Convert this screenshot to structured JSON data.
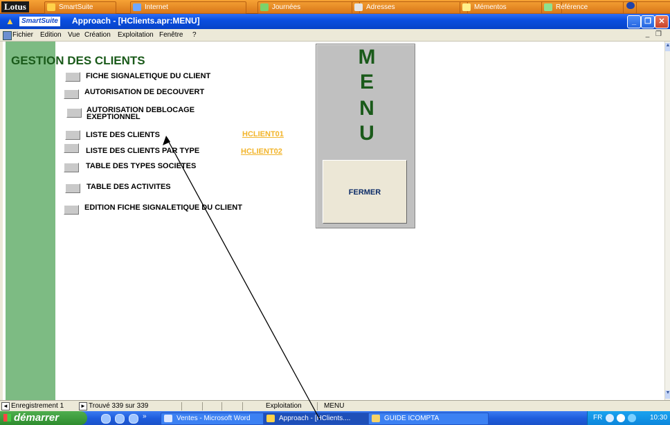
{
  "suitebar": {
    "logo": "Lotus",
    "items": [
      {
        "label": "SmartSuite"
      },
      {
        "label": "Internet"
      },
      {
        "label": "Journées"
      },
      {
        "label": "Adresses"
      },
      {
        "label": "Mémentos"
      },
      {
        "label": "Référence"
      }
    ]
  },
  "titlebar": {
    "brand": "SmartSuite",
    "title": "Approach - [HClients.apr:MENU]",
    "minimize": "_",
    "restore": "❐",
    "close": "✕"
  },
  "menubar": {
    "items": [
      "Fichier",
      "Edition",
      "Vue",
      "Création",
      "Exploitation",
      "Fenêtre",
      "?"
    ]
  },
  "form": {
    "heading": "GESTION DES CLIENTS",
    "buttons": [
      {
        "label": "FICHE SIGNALETIQUE DU CLIENT"
      },
      {
        "label": "AUTORISATION DE DECOUVERT"
      },
      {
        "label": "AUTORISATION DEBLOCAGE\nEXEPTIONNEL"
      },
      {
        "label": "LISTE DES CLIENTS",
        "code": "HCLIENT01"
      },
      {
        "label": "LISTE DES CLIENTS PAR TYPE",
        "code": "HCLIENT02"
      },
      {
        "label": "TABLE DES TYPES SOCIETES"
      },
      {
        "label": "TABLE DES ACTIVITES"
      },
      {
        "label": "EDITION FICHE SIGNALETIQUE DU CLIENT"
      }
    ],
    "menu_letters": [
      "M",
      "E",
      "N",
      "U"
    ],
    "close_label": "FERMER"
  },
  "statusbar": {
    "record": "Enregistrement 1",
    "found": "Trouvé 339 sur 339",
    "mode": "Exploitation",
    "view": "MENU"
  },
  "taskbar": {
    "start": "démarrer",
    "tasks": [
      {
        "label": "Ventes - Microsoft Word"
      },
      {
        "label": "Approach - [HClients...."
      },
      {
        "label": "GUIDE ICOMPTA"
      }
    ],
    "lang": "FR",
    "time": "10:30"
  },
  "colors": {
    "green_bar": "#7dbb83",
    "heading": "#1a5a1a",
    "code_link": "#f2b42a",
    "titlebar": "#0a4fe0"
  }
}
